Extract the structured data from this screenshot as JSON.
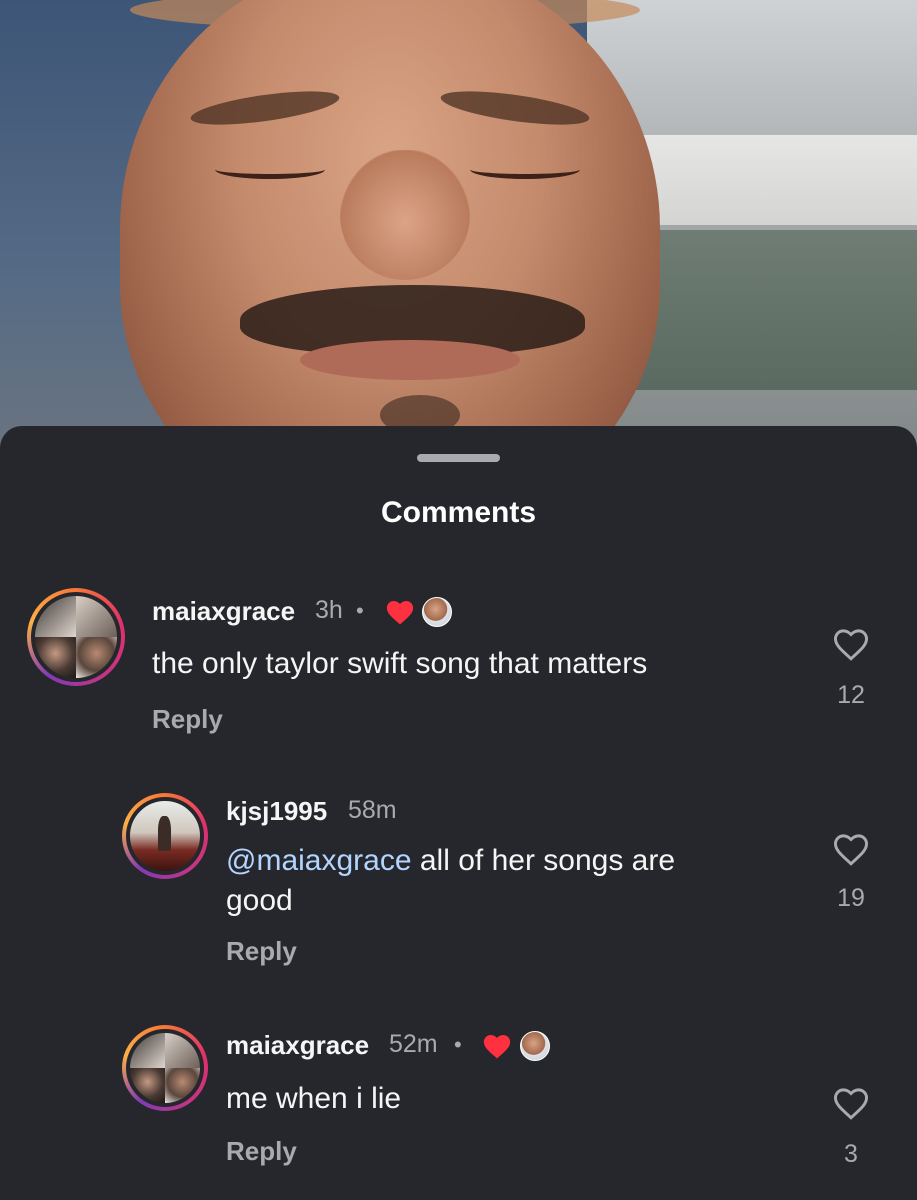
{
  "sheet": {
    "title": "Comments"
  },
  "comments": [
    {
      "username": "maiaxgrace",
      "time": "3h",
      "dot": "•",
      "text": "the only taylor swift song that matters",
      "reply_label": "Reply",
      "like_count": "12",
      "creator_liked": true
    },
    {
      "username": "kjsj1995",
      "time": "58m",
      "mention": "@maiaxgrace",
      "text_line1_rest": " all of her songs are",
      "text_line2": "good",
      "reply_label": "Reply",
      "like_count": "19",
      "creator_liked": false
    },
    {
      "username": "maiaxgrace",
      "time": "52m",
      "dot": "•",
      "text": "me when i lie",
      "reply_label": "Reply",
      "like_count": "3",
      "creator_liked": true
    }
  ],
  "icons": {
    "like": "heart-outline-icon",
    "creator_like": "heart-filled-icon"
  },
  "colors": {
    "background": "#25272c",
    "liked_heart": "#ff3040",
    "mention": "#b3d4ff",
    "secondary_text": "#a8aaae"
  }
}
